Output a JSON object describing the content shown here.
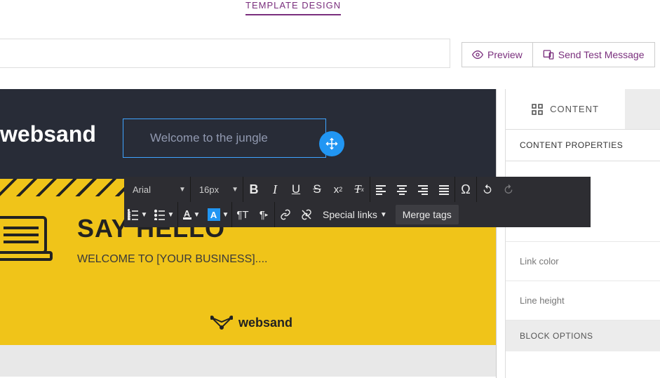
{
  "top_tab": "TEMPLATE DESIGN",
  "actions": {
    "preview": "Preview",
    "send_test": "Send Test Message"
  },
  "email": {
    "logo": "websand",
    "editing_text": "Welcome to the jungle",
    "hero_title": "SAY HELLO",
    "hero_sub": "WELCOME TO [YOUR BUSINESS]....",
    "footer_logo": "websand"
  },
  "toolbar": {
    "font": "Arial",
    "size": "16px",
    "special_links": "Special links",
    "merge_tags": "Merge tags"
  },
  "panel": {
    "tab_content": "CONTENT",
    "section_header": "CONTENT PROPERTIES",
    "link_color": "Link color",
    "line_height": "Line height",
    "block_options": "BLOCK OPTIONS"
  }
}
